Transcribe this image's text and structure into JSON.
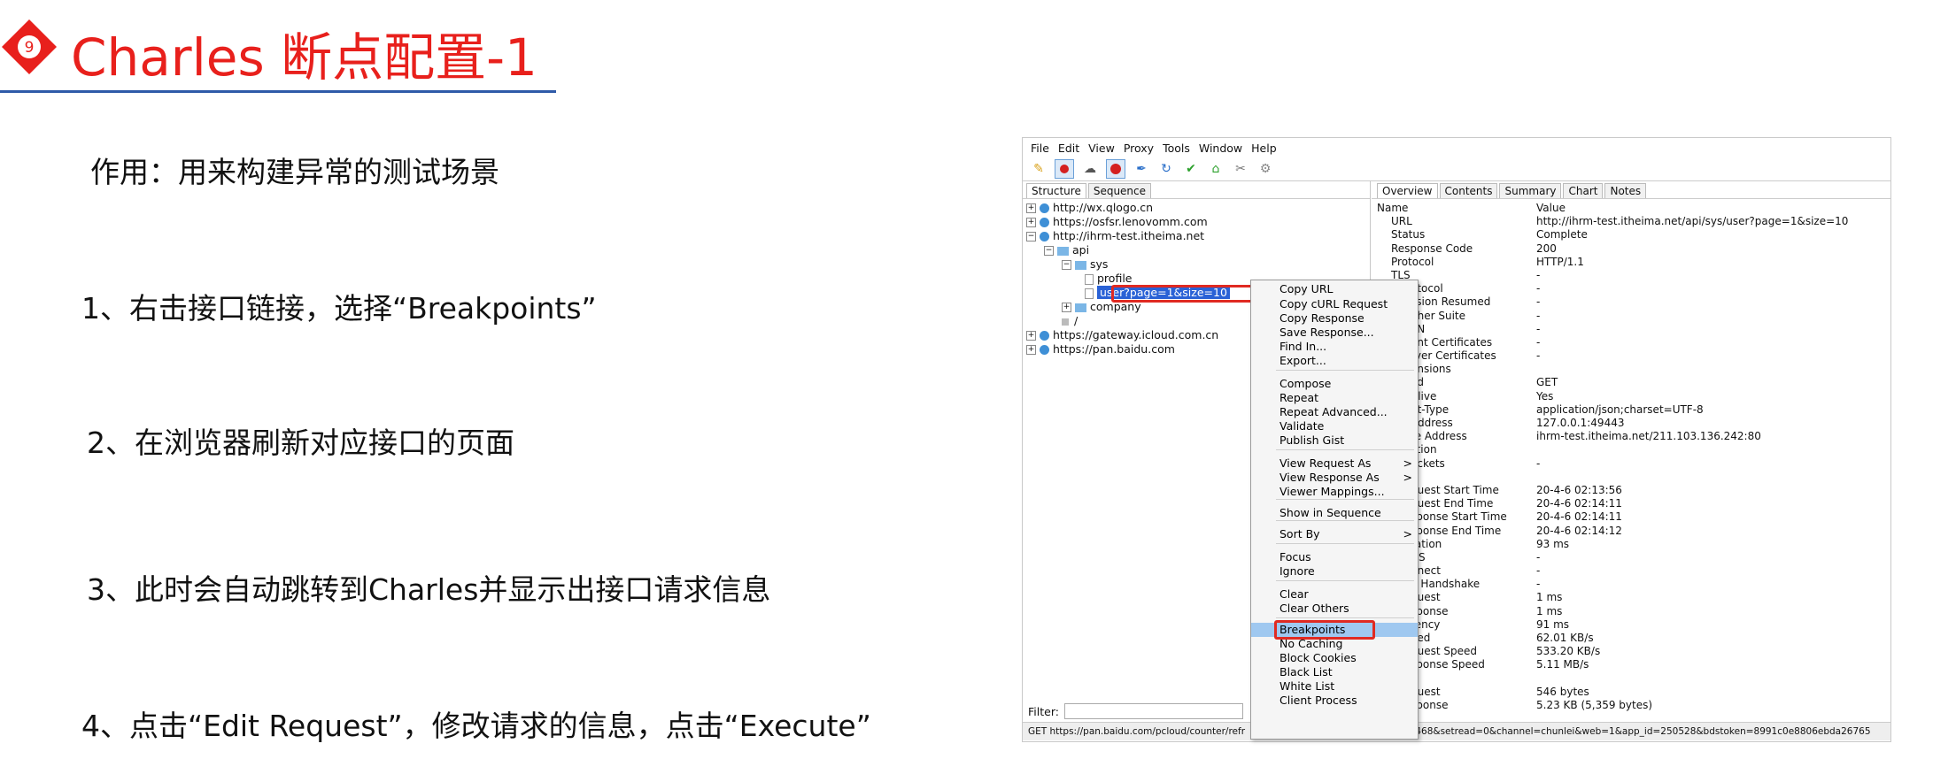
{
  "slide": {
    "badge_number": "9",
    "title": "Charles 断点配置-1",
    "steps": [
      "作用：用来构建异常的测试场景",
      "1、右击接口链接，选择“Breakpoints”",
      "2、在浏览器刷新对应接口的页面",
      "3、此时会自动跳转到Charles并显示出接口请求信息",
      "4、点击“Edit Request”，修改请求的信息，点击“Execute”"
    ],
    "colors": {
      "title": "#e8201c",
      "badge": "#e8201c",
      "rule": "#2e5aa8"
    }
  },
  "charles": {
    "menu": [
      "File",
      "Edit",
      "View",
      "Proxy",
      "Tools",
      "Window",
      "Help"
    ],
    "toolbar_icons": [
      "broom-icon",
      "record-icon",
      "throttle-icon",
      "breakpoint-icon",
      "pen-icon",
      "refresh-icon",
      "tick-icon",
      "basket-icon",
      "tools-icon",
      "gear-icon"
    ],
    "left_tabs": [
      "Structure",
      "Sequence"
    ],
    "tree": [
      {
        "expander": "+",
        "icon": "globe",
        "label": "http://wx.qlogo.cn"
      },
      {
        "expander": "+",
        "icon": "globe",
        "label": "https://osfsr.lenovomm.com"
      },
      {
        "expander": "−",
        "icon": "globe",
        "label": "http://ihrm-test.itheima.net"
      },
      {
        "expander": "−",
        "icon": "folder",
        "label": "api"
      },
      {
        "expander": "−",
        "icon": "folder",
        "label": "sys"
      },
      {
        "expander": "",
        "icon": "",
        "label": "profile"
      },
      {
        "expander": "",
        "icon": "",
        "label": "user?page=1&size=10"
      },
      {
        "expander": "+",
        "icon": "folder",
        "label": "company"
      },
      {
        "expander": "",
        "icon": "",
        "label": "/"
      },
      {
        "expander": "+",
        "icon": "globe",
        "label": "https://gateway.icloud.com.cn"
      },
      {
        "expander": "+",
        "icon": "globe",
        "label": "https://pan.baidu.com"
      }
    ],
    "filter_label": "Filter:",
    "status_text": "GET https://pan.baidu.com/pcloud/counter/refr",
    "status_text_right": "58468&setread=0&channel=chunlei&web=1&app_id=250528&bdstoken=8991c0e8806ebda26765",
    "right_tabs": [
      "Overview",
      "Contents",
      "Summary",
      "Chart",
      "Notes"
    ],
    "overview_header": {
      "name": "Name",
      "value": "Value"
    },
    "overview": [
      {
        "k": "URL",
        "v": "http://ihrm-test.itheima.net/api/sys/user?page=1&size=10"
      },
      {
        "k": "Status",
        "v": "Complete"
      },
      {
        "k": "Response Code",
        "v": "200"
      },
      {
        "k": "Protocol",
        "v": "HTTP/1.1"
      },
      {
        "k": "TLS",
        "v": "-"
      },
      {
        "k": "otocol",
        "v": "-"
      },
      {
        "k": "ssion Resumed",
        "v": "-"
      },
      {
        "k": "pher Suite",
        "v": "-"
      },
      {
        "k": "PN",
        "v": "-"
      },
      {
        "k": "ent Certificates",
        "v": "-"
      },
      {
        "k": "rver Certificates",
        "v": "-"
      },
      {
        "k": "ensions",
        "v": ""
      },
      {
        "k": "od",
        "v": "GET"
      },
      {
        "k": "Alive",
        "v": "Yes"
      },
      {
        "k": "nt-Type",
        "v": "application/json;charset=UTF-8"
      },
      {
        "k": "Address",
        "v": "127.0.0.1:49443"
      },
      {
        "k": "te Address",
        "v": "ihrm-test.itheima.net/211.103.136.242:80"
      },
      {
        "k": "ction",
        "v": ""
      },
      {
        "k": "ockets",
        "v": "-"
      },
      {
        "k": "g",
        "v": ""
      },
      {
        "k": "quest Start Time",
        "v": "20-4-6 02:13:56"
      },
      {
        "k": "quest End Time",
        "v": "20-4-6 02:14:11"
      },
      {
        "k": "sponse Start Time",
        "v": "20-4-6 02:14:11"
      },
      {
        "k": "sponse End Time",
        "v": "20-4-6 02:14:12"
      },
      {
        "k": "ration",
        "v": "93 ms"
      },
      {
        "k": "NS",
        "v": "-"
      },
      {
        "k": "nnect",
        "v": "-"
      },
      {
        "k": "S Handshake",
        "v": "-"
      },
      {
        "k": "quest",
        "v": "1 ms"
      },
      {
        "k": "sponse",
        "v": "1 ms"
      },
      {
        "k": "tency",
        "v": "91 ms"
      },
      {
        "k": "eed",
        "v": "62.01 KB/s"
      },
      {
        "k": "quest Speed",
        "v": "533.20 KB/s"
      },
      {
        "k": "sponse Speed",
        "v": "5.11 MB/s"
      },
      {
        "k": "",
        "v": ""
      },
      {
        "k": "quest",
        "v": "546 bytes"
      },
      {
        "k": "sponse",
        "v": "5.23 KB (5,359 bytes)"
      }
    ],
    "context_menu": [
      {
        "label": "Copy URL"
      },
      {
        "label": "Copy cURL Request"
      },
      {
        "label": "Copy Response"
      },
      {
        "label": "Save Response..."
      },
      {
        "label": "Find In..."
      },
      {
        "label": "Export..."
      },
      {
        "label": "Compose"
      },
      {
        "label": "Repeat"
      },
      {
        "label": "Repeat Advanced..."
      },
      {
        "label": "Validate"
      },
      {
        "label": "Publish Gist"
      },
      {
        "label": "View Request As",
        "sub": ">"
      },
      {
        "label": "View Response As",
        "sub": ">"
      },
      {
        "label": "Viewer Mappings..."
      },
      {
        "label": "Show in Sequence"
      },
      {
        "label": "Sort By",
        "sub": ">"
      },
      {
        "label": "Focus"
      },
      {
        "label": "Ignore"
      },
      {
        "label": "Clear"
      },
      {
        "label": "Clear Others"
      },
      {
        "label": "Breakpoints",
        "highlighted": true
      },
      {
        "label": "No Caching"
      },
      {
        "label": "Block Cookies"
      },
      {
        "label": "Black List"
      },
      {
        "label": "White List"
      },
      {
        "label": "Client Process"
      }
    ]
  }
}
